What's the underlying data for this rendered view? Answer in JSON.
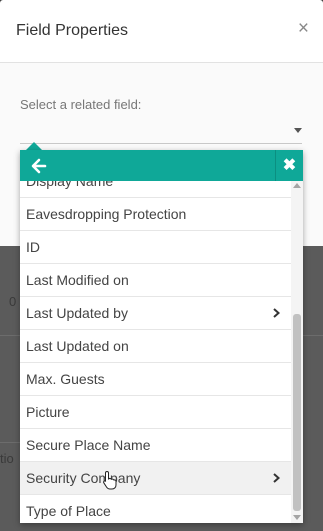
{
  "dialog": {
    "title": "Field Properties",
    "close_glyph": "×"
  },
  "field": {
    "label": "Select a related field:",
    "value": ""
  },
  "popup": {
    "back_icon": "arrow-left-icon",
    "close_glyph": "✖",
    "items": [
      {
        "label": "Display Name",
        "has_submenu": false
      },
      {
        "label": "Eavesdropping Protection",
        "has_submenu": false
      },
      {
        "label": "ID",
        "has_submenu": false
      },
      {
        "label": "Last Modified on",
        "has_submenu": false
      },
      {
        "label": "Last Updated by",
        "has_submenu": true
      },
      {
        "label": "Last Updated on",
        "has_submenu": false
      },
      {
        "label": "Max. Guests",
        "has_submenu": false
      },
      {
        "label": "Picture",
        "has_submenu": false
      },
      {
        "label": "Secure Place Name",
        "has_submenu": false
      },
      {
        "label": "Security Company",
        "has_submenu": true,
        "hovered": true
      },
      {
        "label": "Type of Place",
        "has_submenu": false
      }
    ]
  },
  "background": {
    "fragment_a": "0",
    "fragment_b": "tio"
  },
  "colors": {
    "accent": "#0fa898",
    "overlay": "#5b5b5b"
  }
}
